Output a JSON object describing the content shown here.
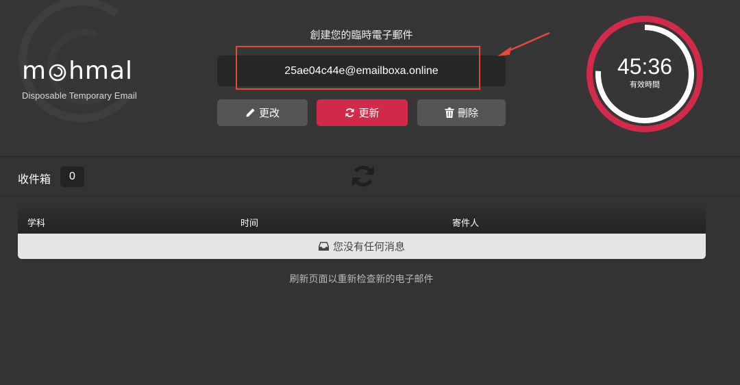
{
  "brand": {
    "logo_left": "m",
    "logo_right": "hmal",
    "tagline": "Disposable Temporary Email"
  },
  "header": {
    "create_title": "創建您的臨時電子郵件",
    "email_address": "25ae04c44e@emailboxa.online"
  },
  "actions": {
    "edit_label": "更改",
    "refresh_label": "更新",
    "delete_label": "刪除"
  },
  "timer": {
    "time": "45:36",
    "label": "有效時間",
    "remaining_fraction": 0.76,
    "ring_color": "#d22a4a"
  },
  "inbox": {
    "label": "收件箱",
    "count": "0"
  },
  "table": {
    "columns": [
      "学科",
      "时间",
      "寄件人"
    ],
    "empty_message": "您没有任何消息"
  },
  "hint": "刷新页面以重新检查新的电子邮件",
  "colors": {
    "accent": "#d22a4a",
    "annotation": "#e8473e"
  }
}
